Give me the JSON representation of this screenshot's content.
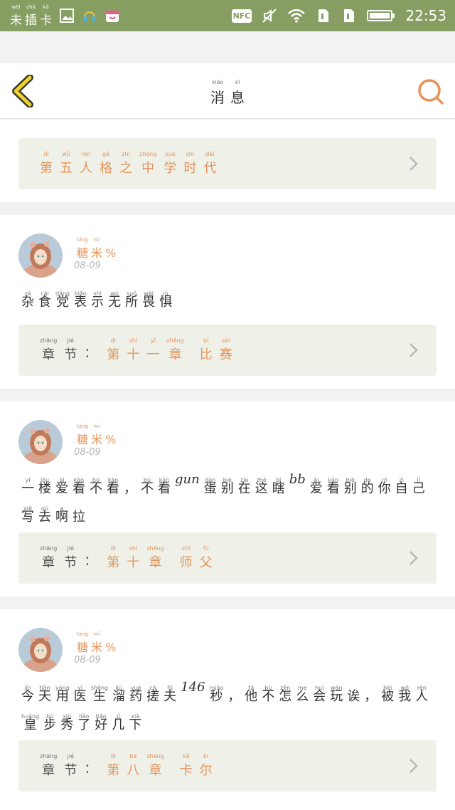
{
  "status_bar": {
    "carrier_chars": [
      {
        "py": "wèi",
        "hz": "未"
      },
      {
        "py": "chā",
        "hz": "插"
      },
      {
        "py": "kǎ",
        "hz": "卡"
      }
    ],
    "nfc_label": "NFC",
    "time": "22:53"
  },
  "header": {
    "title": [
      {
        "py": "xiāo",
        "hz": "消"
      },
      {
        "py": "xī",
        "hz": "息"
      }
    ],
    "accent_color": "#e5935a",
    "back_color": "#f0d230"
  },
  "partial_card": {
    "text": "",
    "chapter_title": [
      {
        "py": "dì",
        "hz": "第"
      },
      {
        "py": "wǔ",
        "hz": "五"
      },
      {
        "py": "rén",
        "hz": "人"
      },
      {
        "py": "gé",
        "hz": "格"
      },
      {
        "py": "zhī",
        "hz": "之"
      },
      {
        "py": "zhōng",
        "hz": "中"
      },
      {
        "py": "xué",
        "hz": "学"
      },
      {
        "py": "shí",
        "hz": "时"
      },
      {
        "py": "dài",
        "hz": "代"
      }
    ]
  },
  "chapter_label": [
    {
      "py": "zhāng",
      "hz": "章"
    },
    {
      "py": "jié",
      "hz": "节"
    }
  ],
  "chapter_colon": "：",
  "posts": [
    {
      "username": [
        {
          "py": "táng",
          "hz": "糖"
        },
        {
          "py": "mǐ",
          "hz": "米"
        }
      ],
      "username_suffix": "%",
      "date": "08-09",
      "body": [
        {
          "py": "zá",
          "hz": "杂"
        },
        {
          "py": "cài",
          "hz": "食"
        },
        {
          "py": "dǎng",
          "hz": "党"
        },
        {
          "py": "biǎo",
          "hz": "表"
        },
        {
          "py": "shì",
          "hz": "示"
        },
        {
          "py": "wú",
          "hz": "无"
        },
        {
          "py": "suǒ",
          "hz": "所"
        },
        {
          "py": "wèi",
          "hz": "畏"
        },
        {
          "py": "jù",
          "hz": "惧"
        }
      ],
      "chapter_title_a": [
        {
          "py": "dì",
          "hz": "第"
        },
        {
          "py": "shí",
          "hz": "十"
        },
        {
          "py": "yī",
          "hz": "一"
        },
        {
          "py": "zhāng",
          "hz": "章"
        }
      ],
      "chapter_title_b": [
        {
          "py": "bǐ",
          "hz": "比"
        },
        {
          "py": "sài",
          "hz": "赛"
        }
      ]
    },
    {
      "username": [
        {
          "py": "táng",
          "hz": "糖"
        },
        {
          "py": "mǐ",
          "hz": "米"
        }
      ],
      "username_suffix": "%",
      "date": "08-09",
      "body": [
        {
          "py": "yī",
          "hz": "一"
        },
        {
          "py": "lóu",
          "hz": "楼"
        },
        {
          "py": "ài",
          "hz": "爱"
        },
        {
          "py": "kàn",
          "hz": "看"
        },
        {
          "py": "bú",
          "hz": "不"
        },
        {
          "py": "kàn",
          "hz": "看"
        },
        {
          "py": "",
          "hz": "，"
        },
        {
          "py": "bú",
          "hz": "不"
        },
        {
          "py": "kàn",
          "hz": "看"
        },
        {
          "lat": "gun"
        },
        {
          "py": "dàn",
          "hz": "蛋"
        },
        {
          "py": "bié",
          "hz": "别"
        },
        {
          "py": "zài",
          "hz": "在"
        },
        {
          "py": "zhè",
          "hz": "这"
        },
        {
          "py": "bī",
          "hz": "瞎"
        },
        {
          "lat": "bb"
        },
        {
          "py": "ài",
          "hz": "爱"
        },
        {
          "py": "kàn",
          "hz": "看"
        },
        {
          "py": "bié",
          "hz": "别"
        },
        {
          "py": "de",
          "hz": "的"
        },
        {
          "py": "nǐ",
          "hz": "你"
        },
        {
          "py": "zì",
          "hz": "自"
        },
        {
          "py": "jǐ",
          "hz": "己"
        },
        {
          "py": "xiě",
          "hz": "写"
        },
        {
          "py": "qù",
          "hz": "去"
        },
        {
          "py": "a",
          "hz": "啊"
        },
        {
          "py": "",
          "hz": "拉"
        }
      ],
      "chapter_title_a": [
        {
          "py": "dì",
          "hz": "第"
        },
        {
          "py": "shí",
          "hz": "十"
        },
        {
          "py": "zhāng",
          "hz": "章"
        }
      ],
      "chapter_title_b": [
        {
          "py": "shī",
          "hz": "师"
        },
        {
          "py": "fù",
          "hz": "父"
        }
      ]
    },
    {
      "username": [
        {
          "py": "táng",
          "hz": "糖"
        },
        {
          "py": "mǐ",
          "hz": "米"
        }
      ],
      "username_suffix": "%",
      "date": "08-09",
      "body": [
        {
          "py": "jīn",
          "hz": "今"
        },
        {
          "py": "tiān",
          "hz": "天"
        },
        {
          "py": "yòng",
          "hz": "用"
        },
        {
          "py": "yī",
          "hz": "医"
        },
        {
          "py": "shēng",
          "hz": "生"
        },
        {
          "py": "liū",
          "hz": "溜"
        },
        {
          "py": "yuè",
          "hz": "药"
        },
        {
          "py": "cā",
          "hz": "搓"
        },
        {
          "py": "fū",
          "hz": "夫"
        },
        {
          "lat": "146"
        },
        {
          "py": "miǎo",
          "hz": "秒"
        },
        {
          "py": "",
          "hz": "，"
        },
        {
          "py": "tā",
          "hz": "他"
        },
        {
          "py": "bù",
          "hz": "不"
        },
        {
          "py": "zěn",
          "hz": "怎"
        },
        {
          "py": "me",
          "hz": "么"
        },
        {
          "py": "huì",
          "hz": "会"
        },
        {
          "py": "wán",
          "hz": "玩"
        },
        {
          "py": "",
          "hz": "诶"
        },
        {
          "py": "",
          "hz": "，"
        },
        {
          "py": "bèi",
          "hz": "被"
        },
        {
          "py": "wǒ",
          "hz": "我"
        },
        {
          "py": "rén",
          "hz": "人"
        },
        {
          "py": "huáng",
          "hz": "皇"
        },
        {
          "py": "bù",
          "hz": "步"
        },
        {
          "py": "xiù",
          "hz": "秀"
        },
        {
          "py": "liǎo",
          "hz": "了"
        },
        {
          "py": "hǎo",
          "hz": "好"
        },
        {
          "py": "jǐ",
          "hz": "几"
        },
        {
          "py": "xià",
          "hz": "下"
        }
      ],
      "chapter_title_a": [
        {
          "py": "dì",
          "hz": "第"
        },
        {
          "py": "bā",
          "hz": "八"
        },
        {
          "py": "zhāng",
          "hz": "章"
        }
      ],
      "chapter_title_b": [
        {
          "py": "kǎ",
          "hz": "卡"
        },
        {
          "py": "ěr",
          "hz": "尔"
        }
      ]
    }
  ]
}
